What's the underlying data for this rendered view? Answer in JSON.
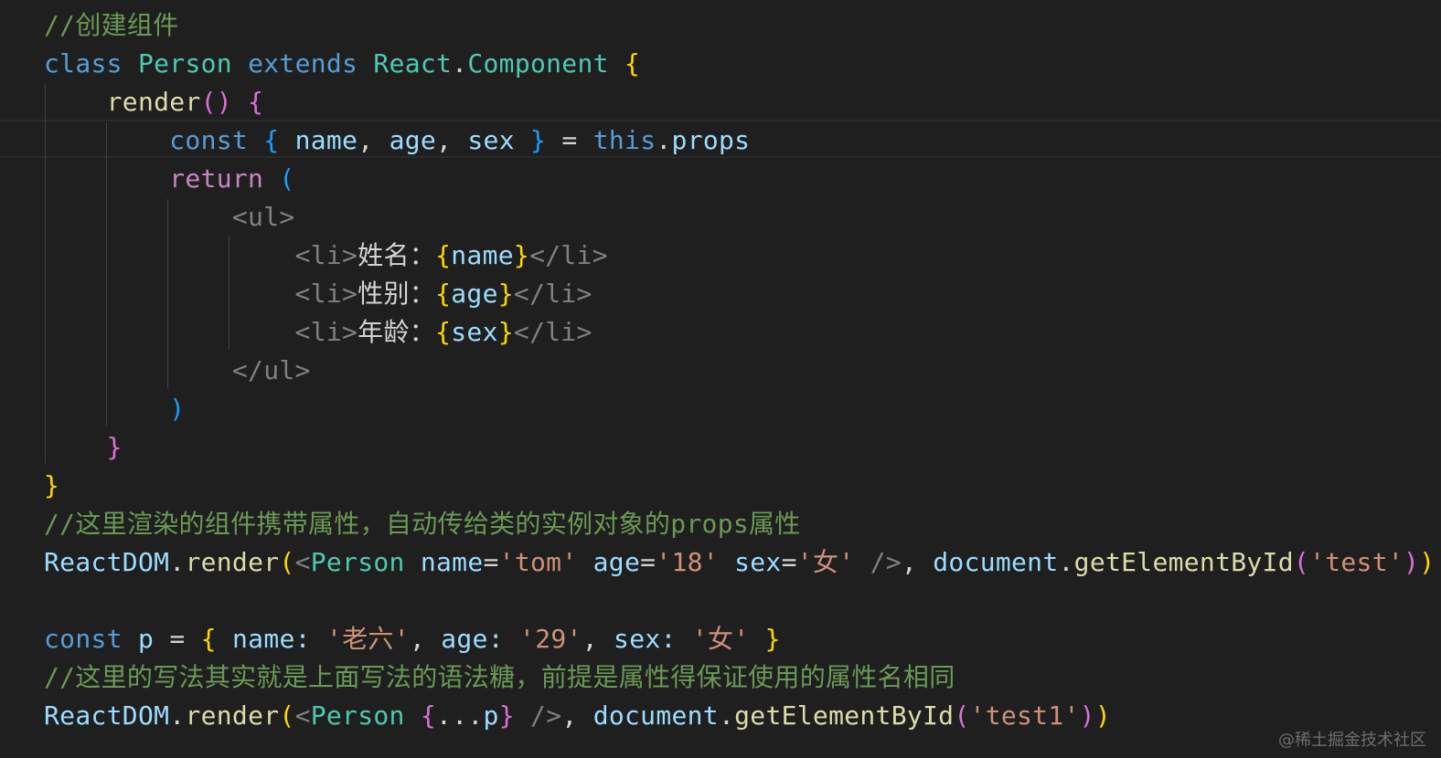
{
  "code": {
    "line1": {
      "comment": "//创建组件"
    },
    "line2": {
      "kw_class": "class",
      "cls_person": "Person",
      "kw_extends": "extends",
      "cls_react": "React",
      "dot": ".",
      "cls_component": "Component",
      "brace": "{"
    },
    "line3": {
      "fn_render": "render",
      "parens": "()",
      "brace": "{"
    },
    "line4": {
      "kw_const": "const",
      "brace_open": "{",
      "v_name": "name",
      "comma1": ",",
      "v_age": "age",
      "comma2": ",",
      "v_sex": "sex",
      "brace_close": "}",
      "eq": "=",
      "kw_this": "this",
      "dot": ".",
      "v_props": "props"
    },
    "line5": {
      "kw_return": "return",
      "paren": "("
    },
    "line6": {
      "tag": "<ul>"
    },
    "line7": {
      "tag_open": "<li>",
      "text": "姓名：",
      "br_open": "{",
      "var": "name",
      "br_close": "}",
      "tag_close": "</li>"
    },
    "line8": {
      "tag_open": "<li>",
      "text": "性别：",
      "br_open": "{",
      "var": "age",
      "br_close": "}",
      "tag_close": "</li>"
    },
    "line9": {
      "tag_open": "<li>",
      "text": "年龄：",
      "br_open": "{",
      "var": "sex",
      "br_close": "}",
      "tag_close": "</li>"
    },
    "line10": {
      "tag": "</ul>"
    },
    "line11": {
      "paren": ")"
    },
    "line12": {
      "brace": "}"
    },
    "line13": {
      "brace": "}"
    },
    "line14": {
      "comment": "//这里渲染的组件携带属性，自动传给类的实例对象的props属性"
    },
    "line15": {
      "obj": "ReactDOM",
      "dot1": ".",
      "fn": "render",
      "paren_open": "(",
      "lt": "<",
      "cls": "Person",
      "a_name": "name",
      "eq1": "=",
      "s_tom": "'tom'",
      "a_age": "age",
      "eq2": "=",
      "s_18": "'18'",
      "a_sex": "sex",
      "eq3": "=",
      "s_nv": "'女'",
      "selfclose": "/>",
      "comma": ",",
      "doc": "document",
      "dot2": ".",
      "fn_get": "getElementById",
      "p2_open": "(",
      "s_test": "'test'",
      "p2_close": ")",
      "paren_close": ")"
    },
    "line17": {
      "kw_const": "const",
      "v_p": "p",
      "eq": "=",
      "br_open": "{",
      "k_name": "name:",
      "s_name": "'老六'",
      "c1": ",",
      "k_age": "age:",
      "s_age": "'29'",
      "c2": ",",
      "k_sex": "sex:",
      "s_sex": "'女'",
      "br_close": "}"
    },
    "line18": {
      "comment": "//这里的写法其实就是上面写法的语法糖，前提是属性得保证使用的属性名相同"
    },
    "line19": {
      "obj": "ReactDOM",
      "dot1": ".",
      "fn": "render",
      "paren_open": "(",
      "lt": "<",
      "cls": "Person",
      "br_open": "{",
      "spread": "...",
      "v_p": "p",
      "br_close": "}",
      "selfclose": "/>",
      "comma": ",",
      "doc": "document",
      "dot2": ".",
      "fn_get": "getElementById",
      "p2_open": "(",
      "s_test1": "'test1'",
      "p2_close": ")",
      "paren_close": ")"
    }
  },
  "watermark": "@稀土掘金技术社区"
}
